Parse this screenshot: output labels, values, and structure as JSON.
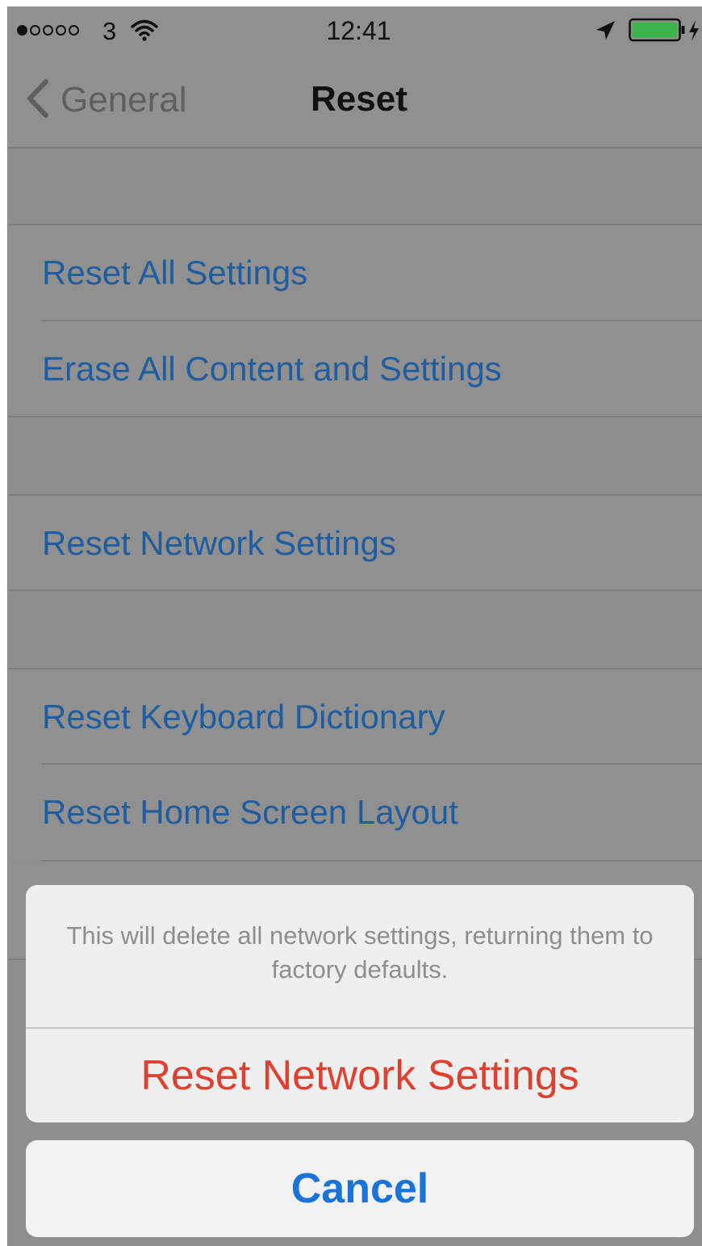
{
  "status_bar": {
    "signal_filled": 1,
    "signal_total": 5,
    "carrier": "3",
    "time": "12:41",
    "icons": [
      "wifi-icon",
      "location-icon",
      "battery-icon",
      "charging-icon"
    ],
    "battery_color": "#3cb44a"
  },
  "nav": {
    "back_label": "General",
    "back_icon": "chevron-left-icon",
    "title": "Reset"
  },
  "sections": [
    {
      "items": [
        "Reset All Settings",
        "Erase All Content and Settings"
      ]
    },
    {
      "items": [
        "Reset Network Settings"
      ]
    },
    {
      "items": [
        "Reset Keyboard Dictionary",
        "Reset Home Screen Layout"
      ]
    }
  ],
  "action_sheet": {
    "message": "This will delete all network settings, returning them to factory defaults.",
    "destructive_label": "Reset Network Settings",
    "cancel_label": "Cancel"
  },
  "colors": {
    "link": "#1f5da1",
    "destructive": "#e0402f",
    "cancel": "#1a73d9"
  }
}
